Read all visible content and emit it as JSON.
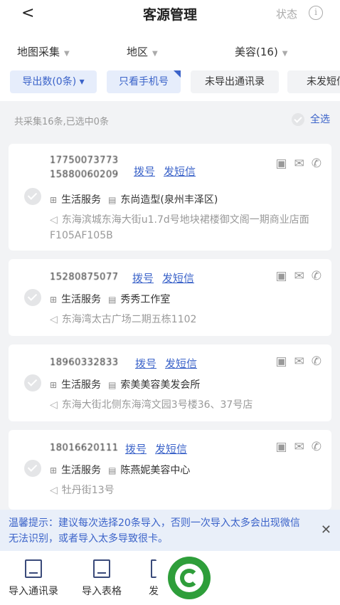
{
  "header": {
    "back_glyph": "<",
    "title": "客源管理",
    "status_label": "状态",
    "info_glyph": "i"
  },
  "filters": [
    {
      "label": "地图采集"
    },
    {
      "label": "地区"
    },
    {
      "label": "美容(16)"
    }
  ],
  "chips": [
    {
      "label": "导出数(0条) ▾",
      "active": true
    },
    {
      "label": "只看手机号",
      "active": true
    },
    {
      "label": "未导出通讯录",
      "active": false
    },
    {
      "label": "未发短信",
      "active": false
    }
  ],
  "summary": {
    "count_text": "共采集16条,已选中0条",
    "select_all": "全选"
  },
  "cards": [
    {
      "phones": [
        "17750073773",
        "15880060209"
      ],
      "dial": "拨号",
      "sms": "发短信",
      "category": "生活服务",
      "shop": "东尚造型(泉州丰泽区)",
      "address": "东海滨城东海大街u1.7d号地块裙楼御文阁一期商业店面F105AF105B"
    },
    {
      "phones": [
        "15280875077"
      ],
      "dial": "拨号",
      "sms": "发短信",
      "category": "生活服务",
      "shop": "秀秀工作室",
      "address": "东海湾太古广场二期五栋1102"
    },
    {
      "phones": [
        "18960332833"
      ],
      "dial": "拨号",
      "sms": "发短信",
      "category": "生活服务",
      "shop": "索美美容美发会所",
      "address": "东海大街北侧东海湾文园3号楼36、37号店"
    },
    {
      "phones": [
        "18016620111"
      ],
      "dial": "拨号",
      "sms": "发短信",
      "category": "生活服务",
      "shop": "陈燕妮美容中心",
      "address": "牡丹街13号"
    }
  ],
  "tip": {
    "text": "温馨提示：建议每次选择20条导入，否则一次导入太多会出现微信无法识别，或者导入太多导致很卡。",
    "close_glyph": "✕"
  },
  "bottom_tabs": [
    {
      "label": "导入通讯录"
    },
    {
      "label": "导入表格"
    },
    {
      "label": "发"
    }
  ],
  "icons": {
    "card_actions": [
      "contact-card-icon",
      "message-icon",
      "phone-icon"
    ],
    "category": "briefcase-icon",
    "shop": "shop-icon",
    "address": "location-arrow-icon",
    "logo": "green-g-logo"
  },
  "colors": {
    "accent": "#3b63c9",
    "tip_bg": "#e9eff9",
    "logo": "#2e9e3a"
  }
}
